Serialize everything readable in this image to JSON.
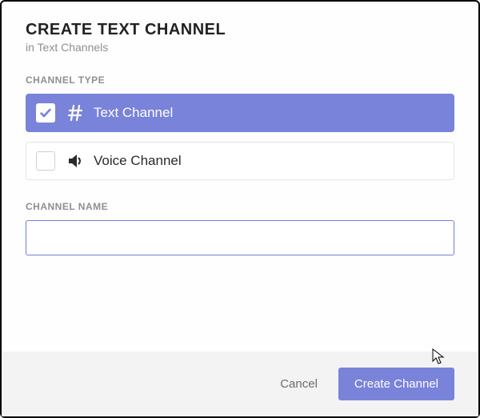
{
  "header": {
    "title": "CREATE TEXT CHANNEL",
    "subtitle": "in Text Channels"
  },
  "channelType": {
    "label": "CHANNEL TYPE",
    "options": [
      {
        "label": "Text Channel",
        "icon": "hash",
        "selected": true
      },
      {
        "label": "Voice Channel",
        "icon": "speaker",
        "selected": false
      }
    ]
  },
  "channelName": {
    "label": "CHANNEL NAME",
    "value": ""
  },
  "footer": {
    "cancel": "Cancel",
    "create": "Create Channel"
  },
  "colors": {
    "accent": "#7983d9"
  }
}
